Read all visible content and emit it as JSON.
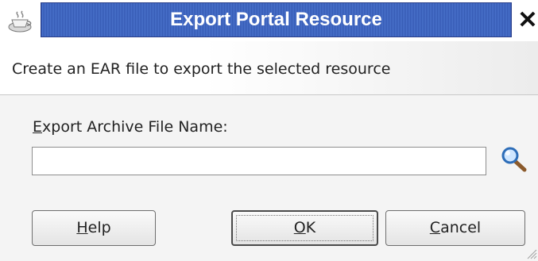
{
  "window": {
    "title": "Export Portal Resource",
    "close_glyph": "✕",
    "icon": "coffee-cup-icon",
    "title_bar_color": "#3f66c0"
  },
  "header": {
    "description": "Create an EAR file to export the selected resource"
  },
  "form": {
    "field_label": {
      "mnemonic": "E",
      "rest": "xport Archive File Name:"
    },
    "field_value": "",
    "browse_icon": "magnifier-icon"
  },
  "buttons": {
    "help": {
      "mnemonic": "H",
      "rest": "elp"
    },
    "ok": {
      "mnemonic": "O",
      "rest": "K"
    },
    "cancel": {
      "mnemonic": "C",
      "rest": "ancel"
    }
  }
}
